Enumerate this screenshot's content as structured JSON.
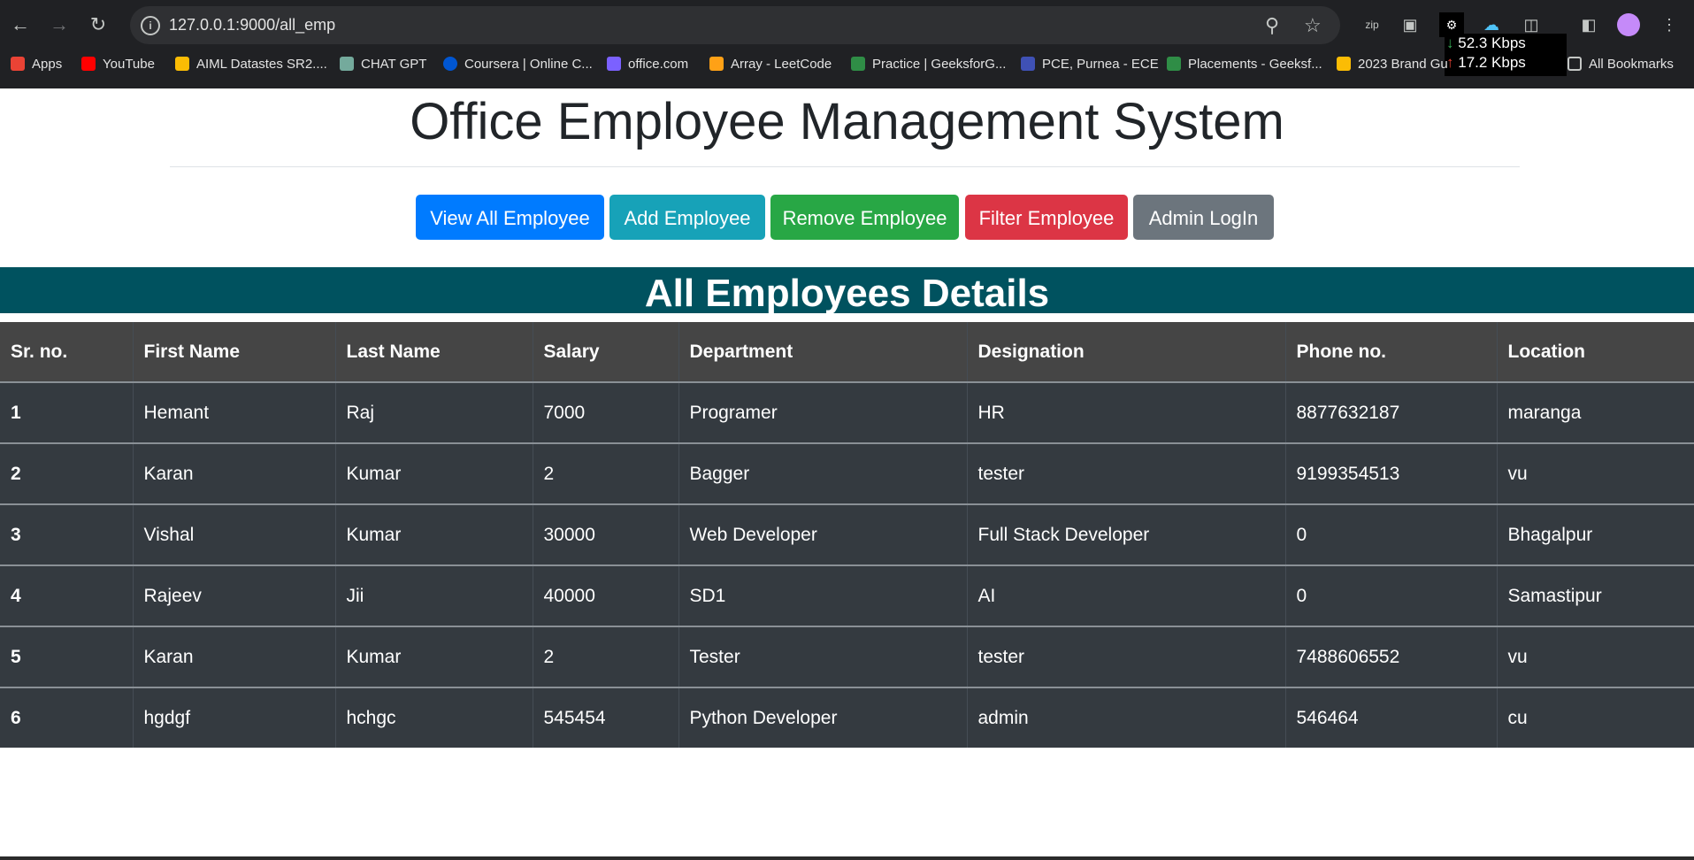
{
  "browser": {
    "url": "127.0.0.1:9000/all_emp",
    "net_speed": {
      "down": "52.3 Kbps",
      "up": "17.2 Kbps"
    },
    "bookmarks": [
      {
        "label": "Apps",
        "icon": "apps-grid-icon",
        "color": "#ea4335"
      },
      {
        "label": "YouTube",
        "icon": "youtube-icon",
        "color": "#ff0000"
      },
      {
        "label": "AIML Datastes SR2....",
        "icon": "google-drive-icon",
        "color": "#fbbc04"
      },
      {
        "label": "CHAT GPT",
        "icon": "chatgpt-icon",
        "color": "#74aa9c"
      },
      {
        "label": "Coursera | Online C...",
        "icon": "coursera-icon",
        "color": "#0056d2"
      },
      {
        "label": "office.com",
        "icon": "office-icon",
        "color": "#7b61ff"
      },
      {
        "label": "Array - LeetCode",
        "icon": "leetcode-icon",
        "color": "#ffa116"
      },
      {
        "label": "Practice | GeeksforG...",
        "icon": "geeksforgeeks-icon",
        "color": "#2f8d46"
      },
      {
        "label": "PCE, Purnea - ECE",
        "icon": "college-icon",
        "color": "#3f51b5"
      },
      {
        "label": "Placements - Geeksf...",
        "icon": "geeksforgeeks-icon",
        "color": "#2f8d46"
      },
      {
        "label": "2023 Brand Gu",
        "icon": "google-drive-icon",
        "color": "#fbbc04"
      },
      {
        "label": "All Bookmarks",
        "icon": "folder-icon",
        "color": "#c4c7c5"
      }
    ]
  },
  "page": {
    "title": "Office Employee Management System",
    "buttons": {
      "view_all": "View All Employee",
      "add": "Add Employee",
      "remove": "Remove Employee",
      "filter": "Filter Employee",
      "admin": "Admin LogIn"
    },
    "section_title": "All Employees Details"
  },
  "table": {
    "headers": [
      "Sr. no.",
      "First Name",
      "Last Name",
      "Salary",
      "Department",
      "Designation",
      "Phone no.",
      "Location"
    ],
    "rows": [
      [
        "1",
        "Hemant",
        "Raj",
        "7000",
        "Programer",
        "HR",
        "8877632187",
        "maranga"
      ],
      [
        "2",
        "Karan",
        "Kumar",
        "2",
        "Bagger",
        "tester",
        "9199354513",
        "vu"
      ],
      [
        "3",
        "Vishal",
        "Kumar",
        "30000",
        "Web Developer",
        "Full Stack Developer",
        "0",
        "Bhagalpur"
      ],
      [
        "4",
        "Rajeev",
        "Jii",
        "40000",
        "SD1",
        "AI",
        "0",
        "Samastipur"
      ],
      [
        "5",
        "Karan",
        "Kumar",
        "2",
        "Tester",
        "tester",
        "7488606552",
        "vu"
      ],
      [
        "6",
        "hgdgf",
        "hchgc",
        "545454",
        "Python Developer",
        "admin",
        "546464",
        "cu"
      ]
    ]
  }
}
